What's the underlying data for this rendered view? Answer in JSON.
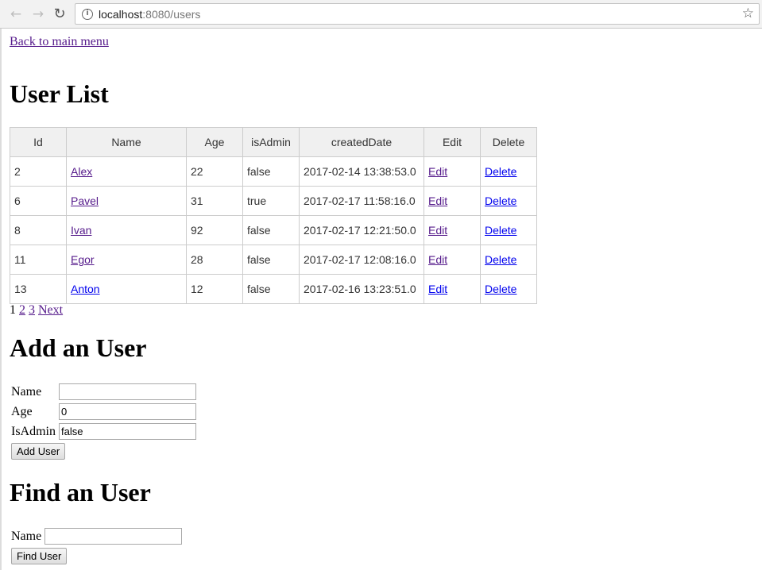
{
  "browser": {
    "url_host": "localhost",
    "url_rest": ":8080/users"
  },
  "back_link": "Back to main menu",
  "user_list": {
    "title": "User List",
    "columns": [
      "Id",
      "Name",
      "Age",
      "isAdmin",
      "createdDate",
      "Edit",
      "Delete"
    ],
    "rows": [
      {
        "id": "2",
        "name": "Alex",
        "age": "22",
        "is_admin": "false",
        "created": "2017-02-14 13:38:53.0",
        "edit": "Edit",
        "delete": "Delete"
      },
      {
        "id": "6",
        "name": "Pavel",
        "age": "31",
        "is_admin": "true",
        "created": "2017-02-17 11:58:16.0",
        "edit": "Edit",
        "delete": "Delete"
      },
      {
        "id": "8",
        "name": "Ivan",
        "age": "92",
        "is_admin": "false",
        "created": "2017-02-17 12:21:50.0",
        "edit": "Edit",
        "delete": "Delete"
      },
      {
        "id": "11",
        "name": "Egor",
        "age": "28",
        "is_admin": "false",
        "created": "2017-02-17 12:08:16.0",
        "edit": "Edit",
        "delete": "Delete"
      },
      {
        "id": "13",
        "name": "Anton",
        "age": "12",
        "is_admin": "false",
        "created": "2017-02-16 13:23:51.0",
        "edit": "Edit",
        "delete": "Delete"
      }
    ]
  },
  "pagination": {
    "current": "1",
    "pages": [
      "2",
      "3"
    ],
    "next": "Next"
  },
  "add_user": {
    "title": "Add an User",
    "name_label": "Name",
    "name_value": "",
    "age_label": "Age",
    "age_value": "0",
    "is_admin_label": "IsAdmin",
    "is_admin_value": "false",
    "button": "Add User"
  },
  "find_user": {
    "title": "Find an User",
    "name_label": "Name",
    "name_value": "",
    "button": "Find User"
  },
  "icons": {
    "back": "back-arrow-icon",
    "forward": "forward-arrow-icon",
    "reload": "reload-icon",
    "info": "info-icon",
    "bookmark": "star-icon"
  }
}
